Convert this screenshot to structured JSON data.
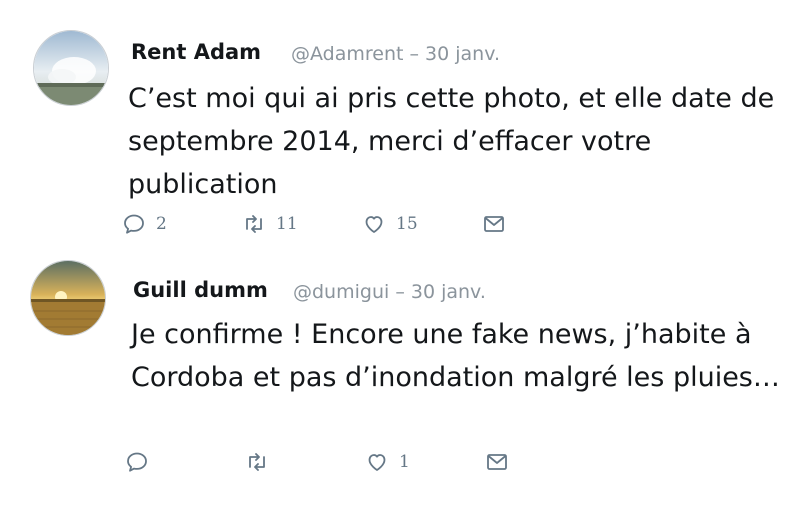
{
  "tweets": [
    {
      "name": "Rent Adam",
      "handle": "@Adamrent",
      "separator": "–",
      "date": "30 janv.",
      "text": "C’est moi qui ai pris cette photo, et elle date de septembre 2014, merci d’effacer votre publication",
      "reply_count": "2",
      "retweet_count": "11",
      "like_count": "15",
      "avatar_icon": "landscape-photo-avatar"
    },
    {
      "name": "Guill dumm",
      "handle": "@dumigui",
      "separator": "–",
      "date": "30 janv.",
      "text": "Je confirme ! Encore une fake news, j’habite à Cordoba et pas d’inondation malgré les pluies…",
      "reply_count": "",
      "retweet_count": "",
      "like_count": "1",
      "avatar_icon": "sunset-field-avatar"
    }
  ],
  "icons": {
    "reply": "reply-icon",
    "retweet": "retweet-icon",
    "like": "heart-icon",
    "message": "envelope-icon"
  },
  "colors": {
    "text": "#14171a",
    "secondary": "#8b949c",
    "action": "#657786"
  }
}
